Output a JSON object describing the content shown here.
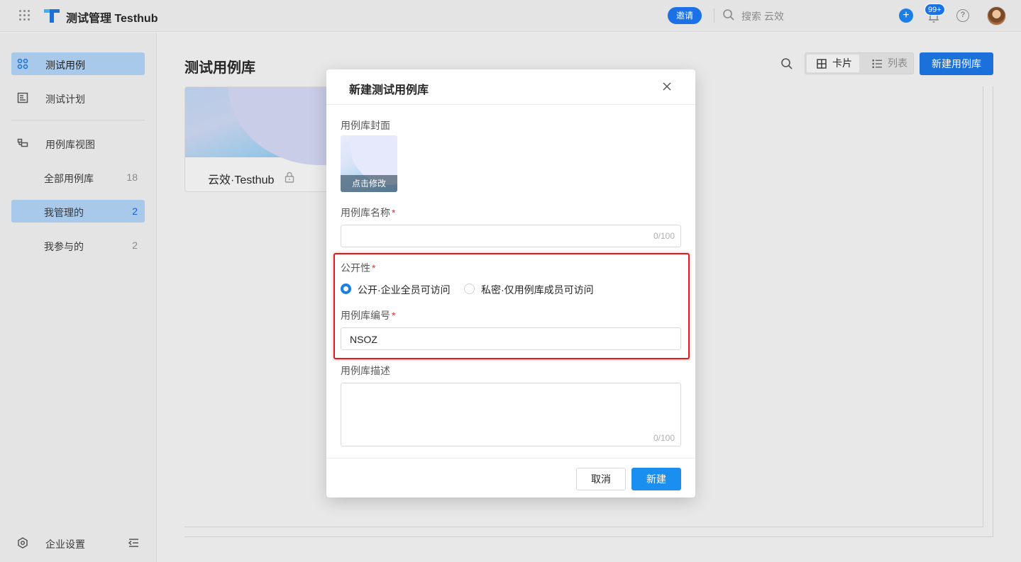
{
  "header": {
    "app_title": "测试管理 Testhub",
    "invite_label": "邀请",
    "search_placeholder": "搜索 云效",
    "notification_badge": "99+",
    "help_glyph": "?"
  },
  "sidebar": {
    "items": [
      {
        "label": "测试用例",
        "icon": "test-case-icon",
        "active": true
      },
      {
        "label": "测试计划",
        "icon": "test-plan-icon",
        "active": false
      },
      {
        "label": "用例库视图",
        "icon": "library-view-icon",
        "active": false
      }
    ],
    "sub_items": [
      {
        "label": "全部用例库",
        "count": "18",
        "active": false
      },
      {
        "label": "我管理的",
        "count": "2",
        "active": true
      },
      {
        "label": "我参与的",
        "count": "2",
        "active": false
      }
    ],
    "bottom": {
      "label": "企业设置",
      "icon": "settings-icon"
    }
  },
  "main": {
    "page_title": "测试用例库",
    "view_card_label": "卡片",
    "view_list_label": "列表",
    "new_library_label": "新建用例库",
    "card": {
      "name": "云效·Testhub"
    }
  },
  "modal": {
    "title": "新建测试用例库",
    "cover_label": "用例库封面",
    "cover_edit": "点击修改",
    "name_label": "用例库名称",
    "name_value": "",
    "name_counter": "0/100",
    "visibility_label": "公开性",
    "visibility_options": [
      {
        "label": "公开·企业全员可访问",
        "checked": true
      },
      {
        "label": "私密·仅用例库成员可访问",
        "checked": false
      }
    ],
    "code_label": "用例库编号",
    "code_value": "NSOZ",
    "desc_label": "用例库描述",
    "desc_counter": "0/100",
    "required_mark": "*",
    "cancel_label": "取消",
    "create_label": "新建"
  },
  "colors": {
    "accent": "#1b71d9",
    "active_nav": "#a8c9ea",
    "highlight": "#e11b1b"
  }
}
